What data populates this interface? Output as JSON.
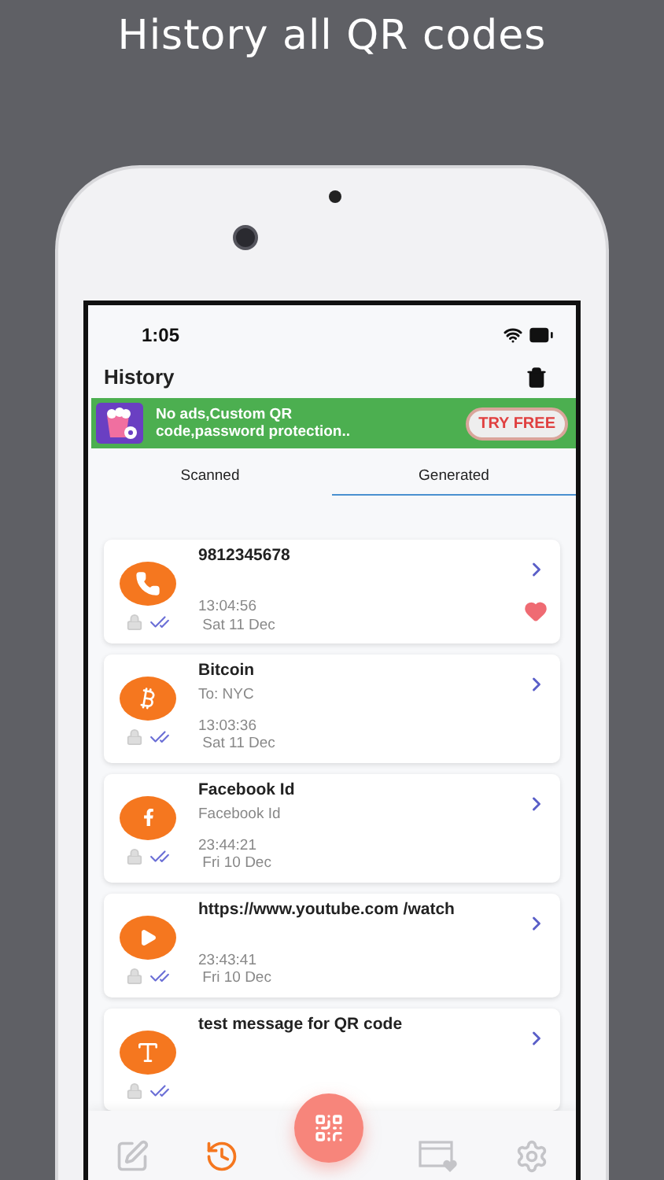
{
  "headline": "History all QR codes",
  "status_bar": {
    "time": "1:05"
  },
  "header": {
    "title": "History"
  },
  "banner": {
    "text": "No ads,Custom QR code,password protection..",
    "button": "TRY FREE"
  },
  "tabs": [
    {
      "label": "Scanned",
      "selected": false
    },
    {
      "label": "Generated",
      "selected": true
    }
  ],
  "items": [
    {
      "kind": "phone",
      "title": "9812345678",
      "time": "13:04:56",
      "date": "Sat 11 Dec",
      "favorite": true
    },
    {
      "kind": "bitcoin",
      "title": "Bitcoin",
      "subtitle": "To: NYC",
      "time": "13:03:36",
      "date": "Sat 11 Dec",
      "favorite": false
    },
    {
      "kind": "facebook",
      "title": "Facebook Id",
      "subtitle": "Facebook Id",
      "time": "23:44:21",
      "date": "Fri 10 Dec",
      "favorite": false
    },
    {
      "kind": "youtube",
      "title": "https://www.youtube.com /watch",
      "time": "23:43:41",
      "date": "Fri 10 Dec",
      "favorite": false
    },
    {
      "kind": "text",
      "title": "test message for QR code",
      "favorite": false
    }
  ],
  "nav": [
    {
      "kind": "create",
      "selected": false
    },
    {
      "kind": "history",
      "selected": true
    },
    {
      "kind": "scan",
      "selected": false
    },
    {
      "kind": "cards",
      "selected": false
    },
    {
      "kind": "settings",
      "selected": false
    }
  ]
}
